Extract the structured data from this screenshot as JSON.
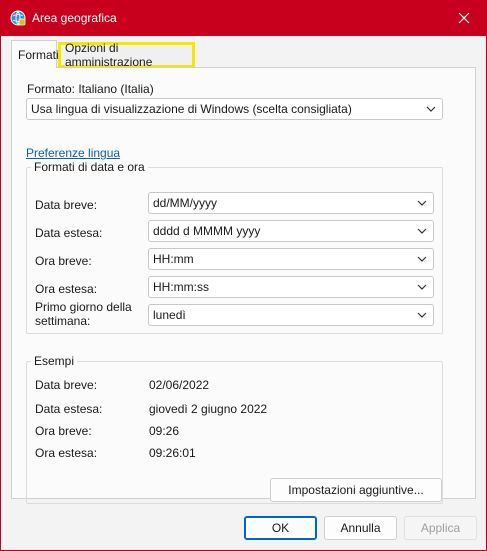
{
  "window": {
    "title": "Area geografica"
  },
  "tabs": [
    {
      "label": "Formati"
    },
    {
      "label": "Opzioni di amministrazione"
    }
  ],
  "formats": {
    "format_label": "Formato: Italiano (Italia)",
    "format_value": "Usa lingua di visualizzazione di Windows (scelta consigliata)",
    "language_prefs_link": "Preferenze lingua",
    "datetime_group_title": "Formati di data e ora",
    "fields": [
      {
        "label": "Data breve:",
        "value": "dd/MM/yyyy"
      },
      {
        "label": "Data estesa:",
        "value": "dddd d MMMM yyyy"
      },
      {
        "label": "Ora breve:",
        "value": "HH:mm"
      },
      {
        "label": "Ora estesa:",
        "value": "HH:mm:ss"
      },
      {
        "label_line1": "Primo giorno della",
        "label_line2": "settimana:",
        "value": "lunedì"
      }
    ],
    "examples_group_title": "Esempi",
    "examples": [
      {
        "label": "Data breve:",
        "value": "02/06/2022"
      },
      {
        "label": "Data estesa:",
        "value": "giovedì 2 giugno 2022"
      },
      {
        "label": "Ora breve:",
        "value": "09:26"
      },
      {
        "label": "Ora estesa:",
        "value": "09:26:01"
      }
    ],
    "additional_settings_button": "Impostazioni aggiuntive..."
  },
  "footer": {
    "ok": "OK",
    "cancel": "Annulla",
    "apply": "Applica"
  },
  "colors": {
    "titlebar": "#c8001e",
    "highlight": "#f7e600",
    "link": "#0a5fb4",
    "accent": "#0067c0"
  }
}
